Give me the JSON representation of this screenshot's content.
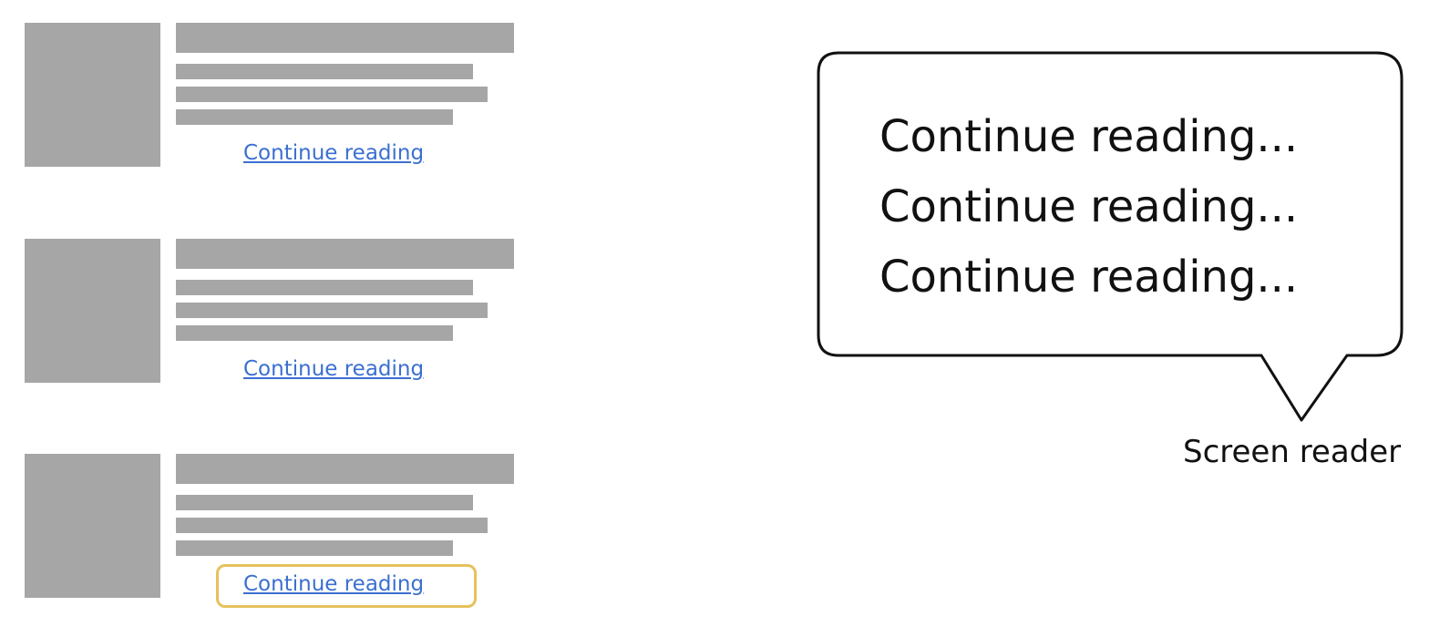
{
  "articles": [
    {
      "link_label": "Continue reading",
      "focused": false
    },
    {
      "link_label": "Continue reading",
      "focused": false
    },
    {
      "link_label": "Continue reading",
      "focused": true
    }
  ],
  "bubble": {
    "lines": [
      "Continue reading...",
      "Continue reading...",
      "Continue reading..."
    ]
  },
  "screen_reader_label": "Screen reader",
  "colors": {
    "placeholder_gray": "#a6a6a6",
    "link_blue": "#3b6fd0",
    "focus_ring": "#e6c15c",
    "text": "#111111"
  }
}
